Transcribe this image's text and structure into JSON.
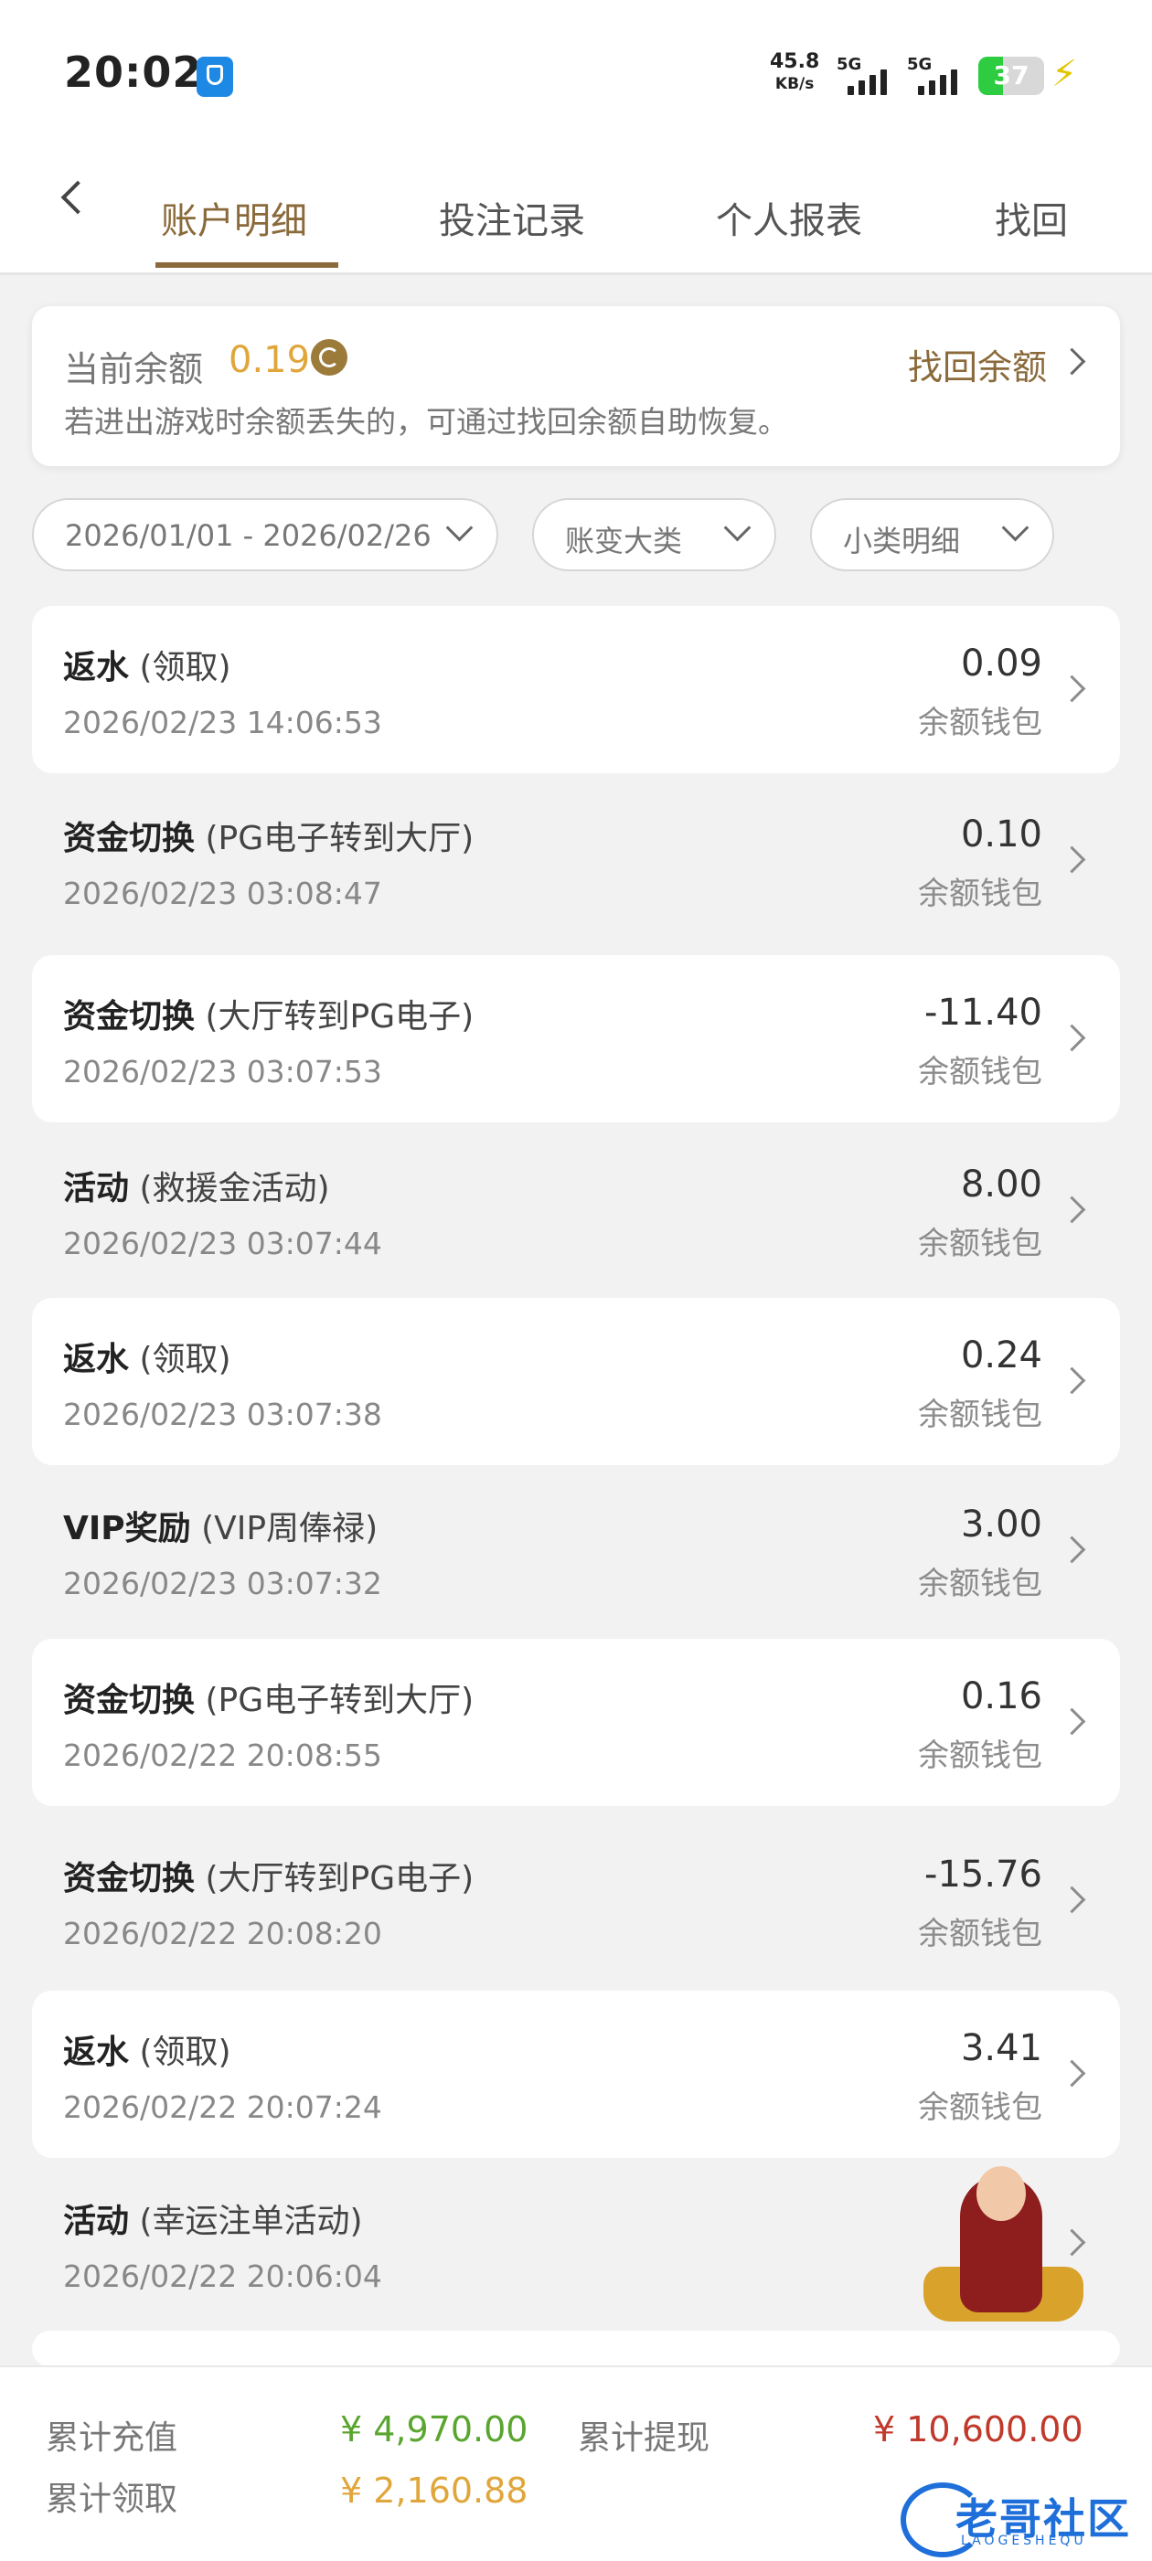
{
  "status_bar": {
    "time": "20:02",
    "net_speed_value": "45.8",
    "net_speed_unit": "KB/s",
    "signal1_label": "5G",
    "signal2_label": "5G",
    "battery_level": "37",
    "icons": [
      "shield-icon",
      "signal-icon",
      "battery-icon",
      "charging-bolt-icon"
    ]
  },
  "tabs": {
    "items": [
      {
        "label": "账户明细",
        "active": true
      },
      {
        "label": "投注记录",
        "active": false
      },
      {
        "label": "个人报表",
        "active": false
      },
      {
        "label": "找回",
        "active": false
      }
    ]
  },
  "balance": {
    "label": "当前余额",
    "value": "0.19",
    "retrieve_label": "找回余额",
    "hint": "若进出游戏时余额丢失的，可通过找回余额自助恢复。"
  },
  "filters": {
    "date_range": "2026/01/01 - 2026/02/26",
    "category": "账变大类",
    "subcategory": "小类明细"
  },
  "records": [
    {
      "type": "返水",
      "detail": "(领取)",
      "date": "2026/02/23 14:06:53",
      "amount": "0.09",
      "wallet": "余额钱包"
    },
    {
      "type": "资金切换",
      "detail": "(PG电子转到大厅)",
      "date": "2026/02/23 03:08:47",
      "amount": "0.10",
      "wallet": "余额钱包"
    },
    {
      "type": "资金切换",
      "detail": "(大厅转到PG电子)",
      "date": "2026/02/23 03:07:53",
      "amount": "-11.40",
      "wallet": "余额钱包"
    },
    {
      "type": "活动",
      "detail": "(救援金活动)",
      "date": "2026/02/23 03:07:44",
      "amount": "8.00",
      "wallet": "余额钱包"
    },
    {
      "type": "返水",
      "detail": "(领取)",
      "date": "2026/02/23 03:07:38",
      "amount": "0.24",
      "wallet": "余额钱包"
    },
    {
      "type": "VIP奖励",
      "detail": "(VIP周俸禄)",
      "date": "2026/02/23 03:07:32",
      "amount": "3.00",
      "wallet": "余额钱包"
    },
    {
      "type": "资金切换",
      "detail": "(PG电子转到大厅)",
      "date": "2026/02/22 20:08:55",
      "amount": "0.16",
      "wallet": "余额钱包"
    },
    {
      "type": "资金切换",
      "detail": "(大厅转到PG电子)",
      "date": "2026/02/22 20:08:20",
      "amount": "-15.76",
      "wallet": "余额钱包"
    },
    {
      "type": "返水",
      "detail": "(领取)",
      "date": "2026/02/22 20:07:24",
      "amount": "3.41",
      "wallet": "余额钱包"
    },
    {
      "type": "活动",
      "detail": "(幸运注单活动)",
      "date": "2026/02/22 20:06:04",
      "amount": "",
      "wallet": "余"
    }
  ],
  "footer": {
    "recharge_label": "累计充值",
    "recharge_value": "¥ 4,970.00",
    "withdraw_label": "累计提现",
    "withdraw_value": "¥ 10,600.00",
    "claim_label": "累计领取",
    "claim_value": "¥ 2,160.88",
    "logo_text": "老哥社区",
    "logo_sub": "LAOGESHEQU"
  },
  "colors": {
    "accent": "#8a6a3a",
    "balance": "#e0a63a",
    "recharge": "#5aa52f",
    "withdraw": "#c0392b",
    "claim": "#e0a63a"
  }
}
